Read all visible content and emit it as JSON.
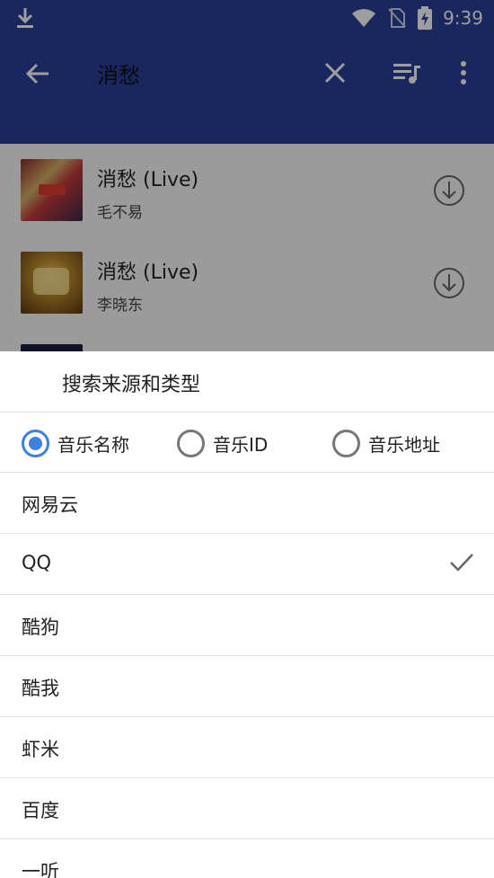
{
  "status_bar": {
    "time": "9:39"
  },
  "toolbar": {
    "title": "消愁"
  },
  "songs": [
    {
      "title": "消愁 (Live)",
      "artist": "毛不易"
    },
    {
      "title": "消愁 (Live)",
      "artist": "李晓东"
    }
  ],
  "sheet": {
    "title": "搜索来源和类型",
    "search_types": [
      {
        "label": "音乐名称",
        "selected": true
      },
      {
        "label": "音乐ID",
        "selected": false
      },
      {
        "label": "音乐地址",
        "selected": false
      }
    ],
    "sources": [
      {
        "label": "网易云",
        "selected": false
      },
      {
        "label": "QQ",
        "selected": true
      },
      {
        "label": "酷狗",
        "selected": false
      },
      {
        "label": "酷我",
        "selected": false
      },
      {
        "label": "虾米",
        "selected": false
      },
      {
        "label": "百度",
        "selected": false
      },
      {
        "label": "一听",
        "selected": false
      }
    ]
  },
  "colors": {
    "appbar": "#2a3f98",
    "accent": "#3f7fe0"
  }
}
